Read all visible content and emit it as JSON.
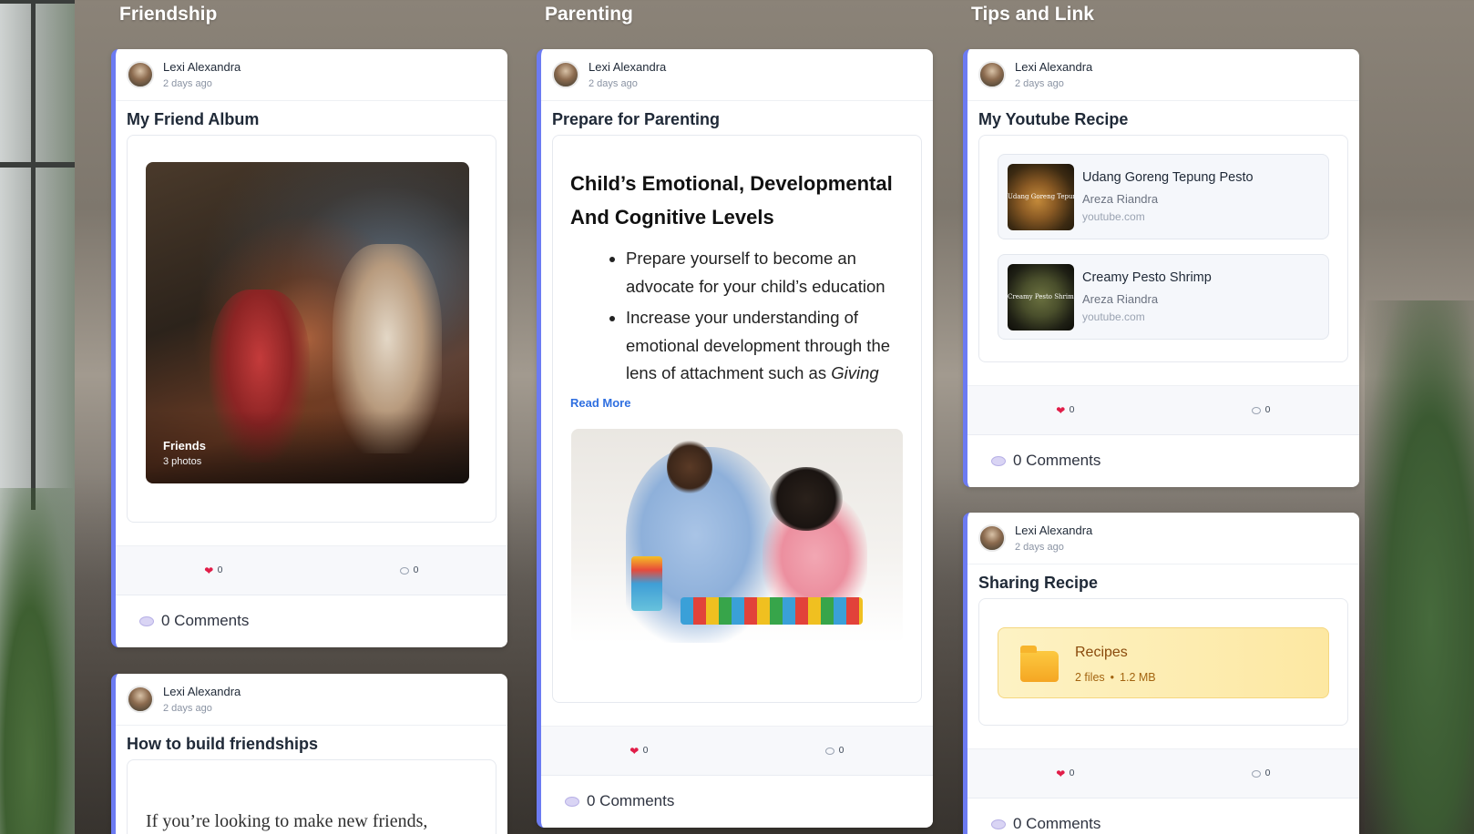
{
  "columns": [
    {
      "title": "Friendship"
    },
    {
      "title": "Parenting"
    },
    {
      "title": "Tips and Link"
    }
  ],
  "posts": {
    "friend_album": {
      "author": "Lexi Alexandra",
      "time": "2 days ago",
      "title": "My Friend Album",
      "album_name": "Friends",
      "album_count": "3 photos",
      "likes": "0",
      "replies": "0",
      "comments_label": "0 Comments"
    },
    "build_friendships": {
      "author": "Lexi Alexandra",
      "time": "2 days ago",
      "title": "How to build friendships",
      "excerpt": "If you’re looking to make new friends,"
    },
    "parenting": {
      "author": "Lexi Alexandra",
      "time": "2 days ago",
      "title": "Prepare for Parenting",
      "article_heading": "Child’s Emotional, Developmental And Cognitive Levels",
      "bullet_1": "Prepare yourself to become an advocate for your child’s education",
      "bullet_2_text": "Increase your understanding of emotional development through the lens of attachment such as ",
      "bullet_2_italic": "Giving the Love that Heals: A",
      "read_more": "Read More",
      "likes": "0",
      "replies": "0",
      "comments_label": "0 Comments"
    },
    "youtube": {
      "author": "Lexi Alexandra",
      "time": "2 days ago",
      "title": "My Youtube Recipe",
      "videos": [
        {
          "title": "Udang Goreng Tepung Pesto",
          "channel": "Areza Riandra",
          "domain": "youtube.com",
          "thumb_text": "Udang Goreng Tepung Pesto"
        },
        {
          "title": "Creamy Pesto Shrimp",
          "channel": "Areza Riandra",
          "domain": "youtube.com",
          "thumb_text": "Creamy Pesto Shrimp"
        }
      ],
      "likes": "0",
      "replies": "0",
      "comments_label": "0 Comments"
    },
    "sharing_recipe": {
      "author": "Lexi Alexandra",
      "time": "2 days ago",
      "title": "Sharing Recipe",
      "folder_name": "Recipes",
      "folder_files": "2 files",
      "folder_separator": "•",
      "folder_size": "1.2 MB",
      "likes": "0",
      "replies": "0",
      "comments_label": "0 Comments"
    }
  },
  "colors": {
    "accent_border": "#6c7bf2",
    "heart": "#e11d48",
    "link": "#2f6fe0",
    "folder_bg": "#fde8a2"
  }
}
